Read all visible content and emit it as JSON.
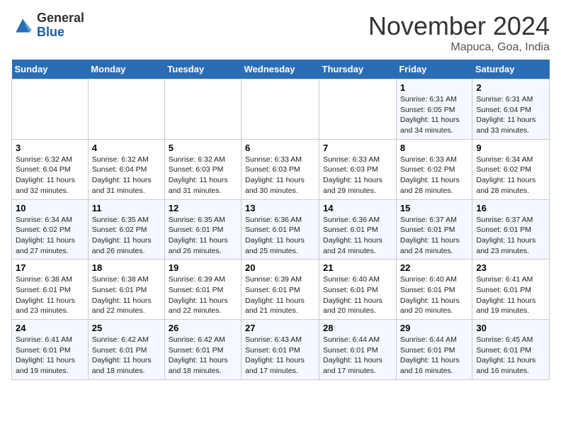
{
  "header": {
    "logo_general": "General",
    "logo_blue": "Blue",
    "month_title": "November 2024",
    "location": "Mapuca, Goa, India"
  },
  "weekdays": [
    "Sunday",
    "Monday",
    "Tuesday",
    "Wednesday",
    "Thursday",
    "Friday",
    "Saturday"
  ],
  "weeks": [
    [
      {
        "day": "",
        "content": ""
      },
      {
        "day": "",
        "content": ""
      },
      {
        "day": "",
        "content": ""
      },
      {
        "day": "",
        "content": ""
      },
      {
        "day": "",
        "content": ""
      },
      {
        "day": "1",
        "content": "Sunrise: 6:31 AM\nSunset: 6:05 PM\nDaylight: 11 hours\nand 34 minutes."
      },
      {
        "day": "2",
        "content": "Sunrise: 6:31 AM\nSunset: 6:04 PM\nDaylight: 11 hours\nand 33 minutes."
      }
    ],
    [
      {
        "day": "3",
        "content": "Sunrise: 6:32 AM\nSunset: 6:04 PM\nDaylight: 11 hours\nand 32 minutes."
      },
      {
        "day": "4",
        "content": "Sunrise: 6:32 AM\nSunset: 6:04 PM\nDaylight: 11 hours\nand 31 minutes."
      },
      {
        "day": "5",
        "content": "Sunrise: 6:32 AM\nSunset: 6:03 PM\nDaylight: 11 hours\nand 31 minutes."
      },
      {
        "day": "6",
        "content": "Sunrise: 6:33 AM\nSunset: 6:03 PM\nDaylight: 11 hours\nand 30 minutes."
      },
      {
        "day": "7",
        "content": "Sunrise: 6:33 AM\nSunset: 6:03 PM\nDaylight: 11 hours\nand 29 minutes."
      },
      {
        "day": "8",
        "content": "Sunrise: 6:33 AM\nSunset: 6:02 PM\nDaylight: 11 hours\nand 28 minutes."
      },
      {
        "day": "9",
        "content": "Sunrise: 6:34 AM\nSunset: 6:02 PM\nDaylight: 11 hours\nand 28 minutes."
      }
    ],
    [
      {
        "day": "10",
        "content": "Sunrise: 6:34 AM\nSunset: 6:02 PM\nDaylight: 11 hours\nand 27 minutes."
      },
      {
        "day": "11",
        "content": "Sunrise: 6:35 AM\nSunset: 6:02 PM\nDaylight: 11 hours\nand 26 minutes."
      },
      {
        "day": "12",
        "content": "Sunrise: 6:35 AM\nSunset: 6:01 PM\nDaylight: 11 hours\nand 26 minutes."
      },
      {
        "day": "13",
        "content": "Sunrise: 6:36 AM\nSunset: 6:01 PM\nDaylight: 11 hours\nand 25 minutes."
      },
      {
        "day": "14",
        "content": "Sunrise: 6:36 AM\nSunset: 6:01 PM\nDaylight: 11 hours\nand 24 minutes."
      },
      {
        "day": "15",
        "content": "Sunrise: 6:37 AM\nSunset: 6:01 PM\nDaylight: 11 hours\nand 24 minutes."
      },
      {
        "day": "16",
        "content": "Sunrise: 6:37 AM\nSunset: 6:01 PM\nDaylight: 11 hours\nand 23 minutes."
      }
    ],
    [
      {
        "day": "17",
        "content": "Sunrise: 6:38 AM\nSunset: 6:01 PM\nDaylight: 11 hours\nand 23 minutes."
      },
      {
        "day": "18",
        "content": "Sunrise: 6:38 AM\nSunset: 6:01 PM\nDaylight: 11 hours\nand 22 minutes."
      },
      {
        "day": "19",
        "content": "Sunrise: 6:39 AM\nSunset: 6:01 PM\nDaylight: 11 hours\nand 22 minutes."
      },
      {
        "day": "20",
        "content": "Sunrise: 6:39 AM\nSunset: 6:01 PM\nDaylight: 11 hours\nand 21 minutes."
      },
      {
        "day": "21",
        "content": "Sunrise: 6:40 AM\nSunset: 6:01 PM\nDaylight: 11 hours\nand 20 minutes."
      },
      {
        "day": "22",
        "content": "Sunrise: 6:40 AM\nSunset: 6:01 PM\nDaylight: 11 hours\nand 20 minutes."
      },
      {
        "day": "23",
        "content": "Sunrise: 6:41 AM\nSunset: 6:01 PM\nDaylight: 11 hours\nand 19 minutes."
      }
    ],
    [
      {
        "day": "24",
        "content": "Sunrise: 6:41 AM\nSunset: 6:01 PM\nDaylight: 11 hours\nand 19 minutes."
      },
      {
        "day": "25",
        "content": "Sunrise: 6:42 AM\nSunset: 6:01 PM\nDaylight: 11 hours\nand 18 minutes."
      },
      {
        "day": "26",
        "content": "Sunrise: 6:42 AM\nSunset: 6:01 PM\nDaylight: 11 hours\nand 18 minutes."
      },
      {
        "day": "27",
        "content": "Sunrise: 6:43 AM\nSunset: 6:01 PM\nDaylight: 11 hours\nand 17 minutes."
      },
      {
        "day": "28",
        "content": "Sunrise: 6:44 AM\nSunset: 6:01 PM\nDaylight: 11 hours\nand 17 minutes."
      },
      {
        "day": "29",
        "content": "Sunrise: 6:44 AM\nSunset: 6:01 PM\nDaylight: 11 hours\nand 16 minutes."
      },
      {
        "day": "30",
        "content": "Sunrise: 6:45 AM\nSunset: 6:01 PM\nDaylight: 11 hours\nand 16 minutes."
      }
    ]
  ]
}
